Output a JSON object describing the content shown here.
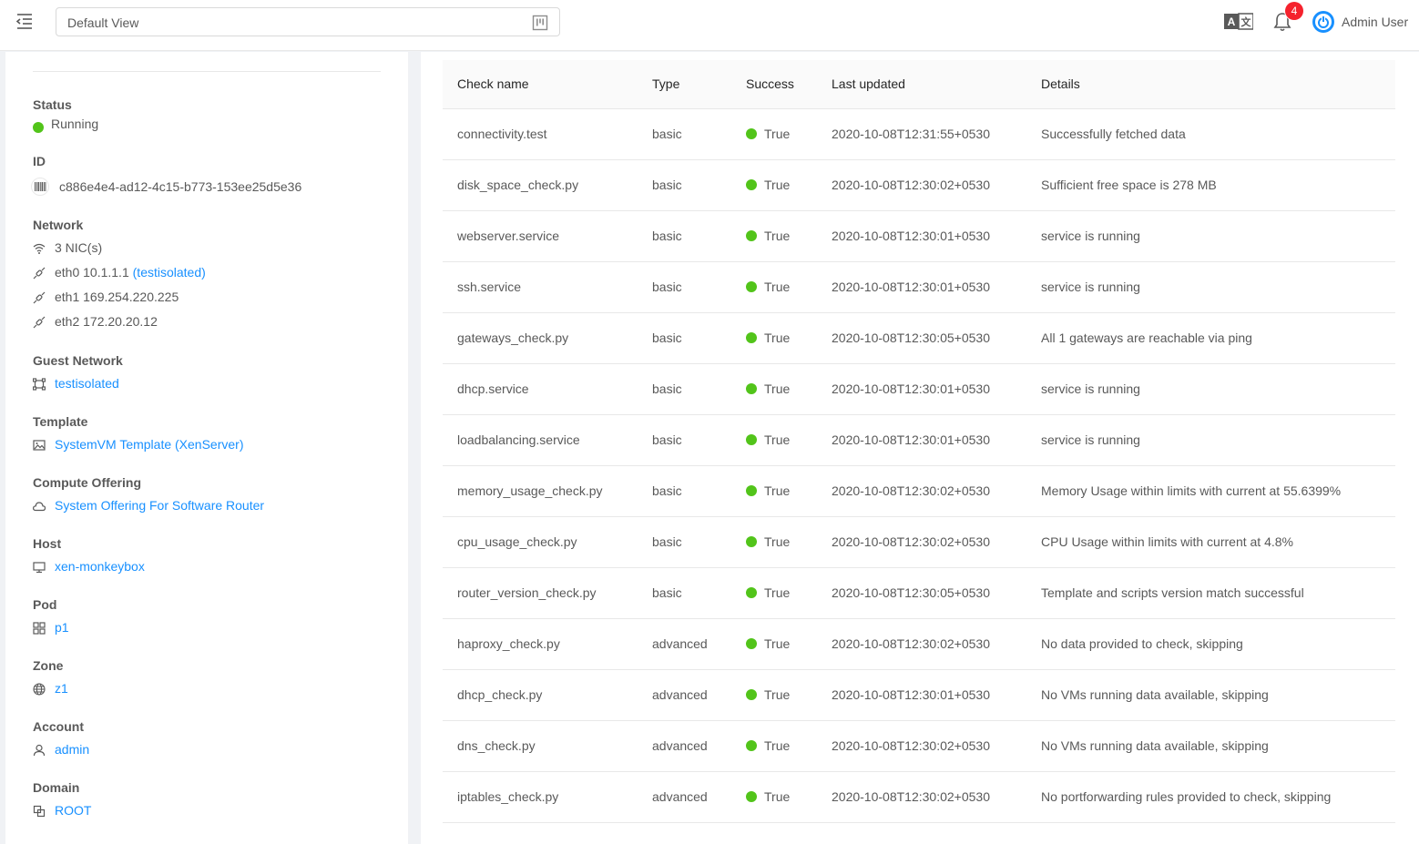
{
  "header": {
    "view_select": "Default View",
    "notification_count": "4",
    "user_name": "Admin User"
  },
  "details": {
    "status": {
      "label": "Status",
      "value": "Running",
      "color": "#52c41a"
    },
    "id": {
      "label": "ID",
      "value": "c886e4e4-ad12-4c15-b773-153ee25d5e36"
    },
    "network": {
      "label": "Network",
      "nics": "3 NIC(s)",
      "eth0": "eth0 10.1.1.1",
      "eth0_net": "(testisolated)",
      "eth1": "eth1 169.254.220.225",
      "eth2": "eth2 172.20.20.12"
    },
    "guest_network": {
      "label": "Guest Network",
      "value": "testisolated"
    },
    "template": {
      "label": "Template",
      "value": "SystemVM Template (XenServer)"
    },
    "compute_offering": {
      "label": "Compute Offering",
      "value": "System Offering For Software Router"
    },
    "host": {
      "label": "Host",
      "value": "xen-monkeybox"
    },
    "pod": {
      "label": "Pod",
      "value": "p1"
    },
    "zone": {
      "label": "Zone",
      "value": "z1"
    },
    "account": {
      "label": "Account",
      "value": "admin"
    },
    "domain": {
      "label": "Domain",
      "value": "ROOT"
    }
  },
  "table": {
    "columns": [
      "Check name",
      "Type",
      "Success",
      "Last updated",
      "Details"
    ],
    "rows": [
      {
        "name": "connectivity.test",
        "type": "basic",
        "success": "True",
        "updated": "2020-10-08T12:31:55+0530",
        "details": "Successfully fetched data"
      },
      {
        "name": "disk_space_check.py",
        "type": "basic",
        "success": "True",
        "updated": "2020-10-08T12:30:02+0530",
        "details": "Sufficient free space is 278 MB"
      },
      {
        "name": "webserver.service",
        "type": "basic",
        "success": "True",
        "updated": "2020-10-08T12:30:01+0530",
        "details": "service is running"
      },
      {
        "name": "ssh.service",
        "type": "basic",
        "success": "True",
        "updated": "2020-10-08T12:30:01+0530",
        "details": "service is running"
      },
      {
        "name": "gateways_check.py",
        "type": "basic",
        "success": "True",
        "updated": "2020-10-08T12:30:05+0530",
        "details": "All 1 gateways are reachable via ping"
      },
      {
        "name": "dhcp.service",
        "type": "basic",
        "success": "True",
        "updated": "2020-10-08T12:30:01+0530",
        "details": "service is running"
      },
      {
        "name": "loadbalancing.service",
        "type": "basic",
        "success": "True",
        "updated": "2020-10-08T12:30:01+0530",
        "details": "service is running"
      },
      {
        "name": "memory_usage_check.py",
        "type": "basic",
        "success": "True",
        "updated": "2020-10-08T12:30:02+0530",
        "details": "Memory Usage within limits with current at 55.6399%"
      },
      {
        "name": "cpu_usage_check.py",
        "type": "basic",
        "success": "True",
        "updated": "2020-10-08T12:30:02+0530",
        "details": "CPU Usage within limits with current at 4.8%"
      },
      {
        "name": "router_version_check.py",
        "type": "basic",
        "success": "True",
        "updated": "2020-10-08T12:30:05+0530",
        "details": "Template and scripts version match successful"
      },
      {
        "name": "haproxy_check.py",
        "type": "advanced",
        "success": "True",
        "updated": "2020-10-08T12:30:02+0530",
        "details": "No data provided to check, skipping"
      },
      {
        "name": "dhcp_check.py",
        "type": "advanced",
        "success": "True",
        "updated": "2020-10-08T12:30:01+0530",
        "details": "No VMs running data available, skipping"
      },
      {
        "name": "dns_check.py",
        "type": "advanced",
        "success": "True",
        "updated": "2020-10-08T12:30:02+0530",
        "details": "No VMs running data available, skipping"
      },
      {
        "name": "iptables_check.py",
        "type": "advanced",
        "success": "True",
        "updated": "2020-10-08T12:30:02+0530",
        "details": "No portforwarding rules provided to check, skipping"
      }
    ]
  },
  "colors": {
    "accent": "#1890ff",
    "success": "#52c41a",
    "badge": "#f5222d"
  }
}
